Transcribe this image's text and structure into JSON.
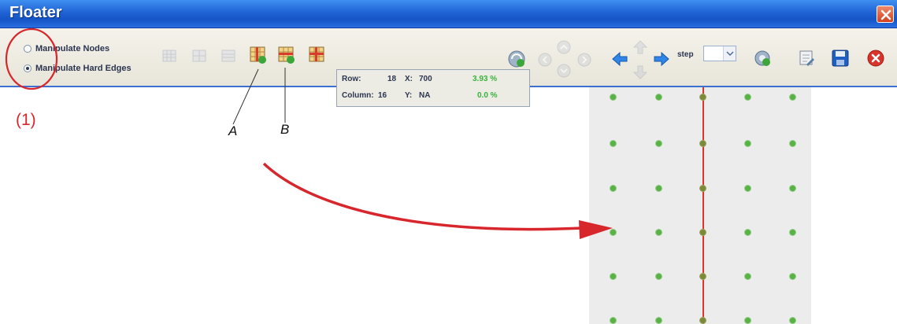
{
  "window": {
    "title": "Floater"
  },
  "toolbar": {
    "mode_options": [
      {
        "label": "Manipulate Nodes",
        "selected": false
      },
      {
        "label": "Manipulate Hard Edges",
        "selected": true
      }
    ],
    "info": {
      "row_label": "Row:",
      "row_value": "18",
      "column_label": "Column:",
      "column_value": "16",
      "x_label": "X:",
      "x_value": "700",
      "y_label": "Y:",
      "y_value": "NA",
      "pct_1": "3.93 %",
      "pct_2": "0.0 %"
    },
    "step_label": "step",
    "step_value": ""
  },
  "annotations": {
    "marker_1": "(1)",
    "label_a": "A",
    "label_b": "B"
  },
  "colors": {
    "annotation_red": "#d7262c",
    "node_green": "#59b246",
    "hard_edge_red": "#e0332d",
    "title_blue": "#1f63d6"
  },
  "icons": [
    "close-icon",
    "grid-icon",
    "grid-icon",
    "grid-icon",
    "add-hard-edge-icon",
    "remove-hard-edge-icon",
    "clear-hard-edges-icon",
    "refresh-icon",
    "nav-left-icon",
    "nav-up-icon",
    "nav-down-icon",
    "nav-right-icon",
    "arrow-left-icon",
    "arrow-up-icon",
    "arrow-right-icon",
    "arrow-down-icon",
    "settings-icon",
    "edit-icon",
    "save-icon",
    "stop-icon"
  ]
}
